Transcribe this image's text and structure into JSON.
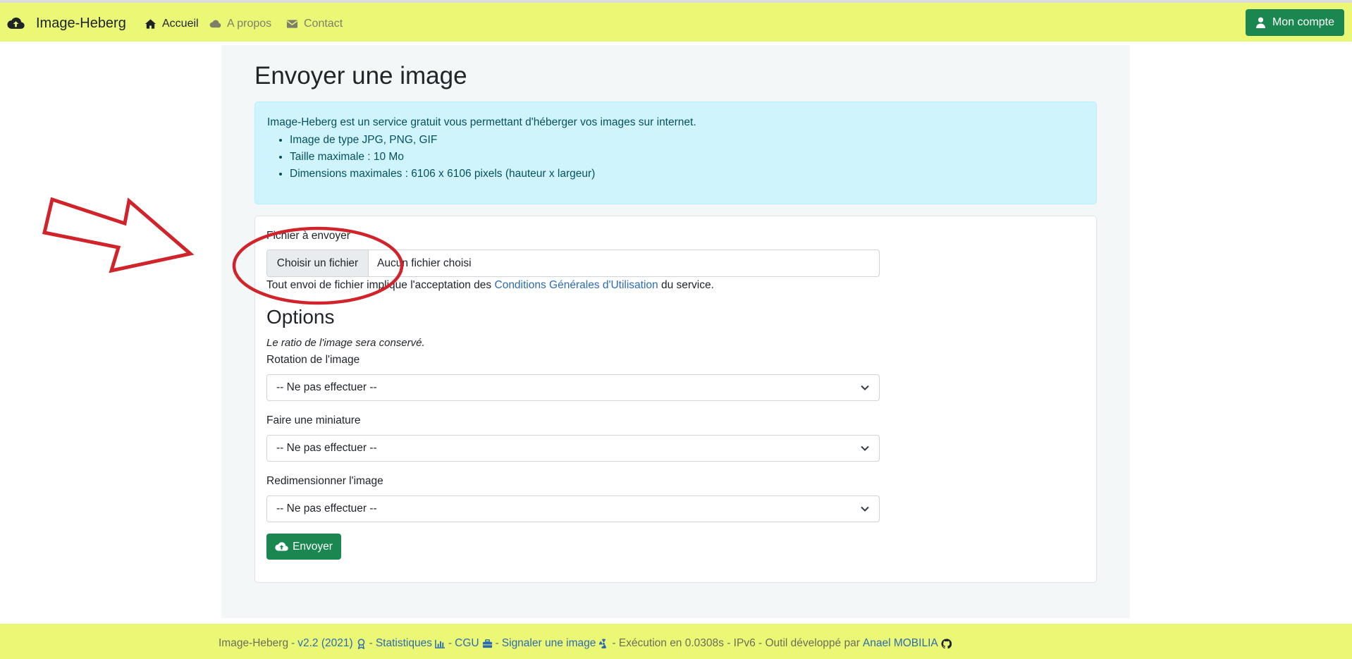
{
  "colors": {
    "navbar_bg": "#ebf876",
    "success_green": "#19874f",
    "info_alert_bg": "#cff4fc",
    "link_blue": "#2d6bb0",
    "annotation_red": "#d0232a"
  },
  "navbar": {
    "brand": "Image-Heberg",
    "brand_icon": "cloud-upload-icon",
    "items": [
      {
        "label": "Accueil",
        "icon": "home-icon"
      },
      {
        "label": "A propos",
        "icon": "cloud-icon"
      },
      {
        "label": "Contact",
        "icon": "envelope-icon"
      }
    ],
    "account_button": {
      "label": "Mon compte",
      "icon": "user-icon"
    }
  },
  "main": {
    "title": "Envoyer une image",
    "info": {
      "intro": "Image-Heberg est un service gratuit vous permettant d'héberger vos images sur internet.",
      "items": [
        "Image de type JPG, PNG, GIF",
        "Taille maximale : 10 Mo",
        "Dimensions maximales : 6106 x 6106 pixels (hauteur x largeur)"
      ]
    },
    "form": {
      "file_label": "Fichier à envoyer",
      "file_button": "Choisir un fichier",
      "file_status": "Aucun fichier choisi",
      "cgu_prefix": "Tout envoi de fichier implique l'acceptation des",
      "cgu_link": "Conditions Générales d'Utilisation",
      "cgu_suffix": "du service.",
      "options_title": "Options",
      "options_note": "Le ratio de l'image sera conservé.",
      "rotation_label": "Rotation de l'image",
      "rotation_value": "-- Ne pas effectuer --",
      "thumbnail_label": "Faire une miniature",
      "thumbnail_value": "-- Ne pas effectuer --",
      "resize_label": "Redimensionner l'image",
      "resize_value": "-- Ne pas effectuer --",
      "submit_label": "Envoyer",
      "submit_icon": "cloud-upload-icon"
    }
  },
  "footer": {
    "app": "Image-Heberg",
    "sep": "-",
    "version": "v2.2 (2021)",
    "version_icon": "award-icon",
    "stats": "Statistiques",
    "stats_icon": "bar-chart-icon",
    "cgu": "CGU",
    "cgu_icon": "briefcase-icon",
    "report": "Signaler une image",
    "report_icon": "radiation-icon",
    "execution": "- Exécution en 0.0308s - IPv6 - Outil développé par",
    "author": "Anael MOBILIA",
    "author_icon": "github-icon"
  },
  "annotation": {
    "arrow_icon": "red-arrow-outline",
    "circle_icon": "red-circle-highlight"
  }
}
